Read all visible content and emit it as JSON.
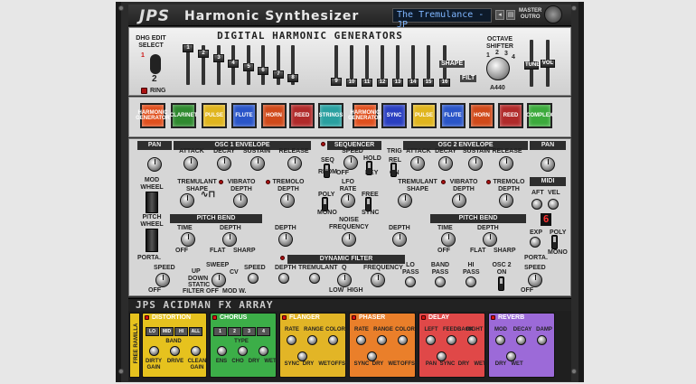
{
  "header": {
    "logo": "JPS",
    "product_name": "Harmonic Synthesizer",
    "patch_name": "The Tremulance - JP",
    "master_outro": [
      "MASTER",
      "OUTRO"
    ]
  },
  "dhg": {
    "title": "DIGITAL HARMONIC GENERATORS",
    "edit_select": [
      "DHG EDIT",
      "SELECT"
    ],
    "edit_values": [
      "1",
      "2"
    ],
    "ring_label": "RING",
    "slider_caps": [
      "1",
      "2",
      "3",
      "4",
      "5",
      "6",
      "7",
      "8",
      "9",
      "10",
      "11",
      "12",
      "13",
      "14",
      "15",
      "16"
    ],
    "shape_label": "SHAPE",
    "filt_label": "FILT",
    "octave_shifter": [
      "OCTAVE",
      "SHIFTER"
    ],
    "octave_marks": [
      "1",
      "2",
      "3",
      "4"
    ],
    "tune_label": "TUNE",
    "vol_label": "VOL",
    "a440": "A440"
  },
  "voices_left": [
    {
      "label": "HARMONIC GENERATOR",
      "color": "#e0501e"
    },
    {
      "label": "CLARINET",
      "color": "#2f8a2f"
    },
    {
      "label": "PULSE",
      "color": "#e0b51e"
    },
    {
      "label": "FLUTE",
      "color": "#2a55c8"
    },
    {
      "label": "HORN",
      "color": "#d04a1a"
    },
    {
      "label": "REED",
      "color": "#b02a2a"
    },
    {
      "label": "STRINGS",
      "color": "#2aa0a0"
    }
  ],
  "voices_right": [
    {
      "label": "HARMONIC GENERATOR",
      "color": "#e0501e"
    },
    {
      "label": "SYNC",
      "color": "#2a3fc0"
    },
    {
      "label": "PULSE",
      "color": "#e0b51e"
    },
    {
      "label": "FLUTE",
      "color": "#2a55c8"
    },
    {
      "label": "HORN",
      "color": "#d04a1a"
    },
    {
      "label": "REED",
      "color": "#b02a2a"
    },
    {
      "label": "COMPLEX",
      "color": "#3caa3c"
    }
  ],
  "panel": {
    "pan": "PAN",
    "osc1_env": "OSC 1 ENVELOPE",
    "osc2_env": "OSC 2 ENVELOPE",
    "env_labels": [
      "ATTACK",
      "DECAY",
      "SUSTAIN",
      "RELEASE"
    ],
    "sequencer": "SEQUENCER",
    "speed": "SPEED",
    "seq": "SEQ",
    "rndm": "RNDM",
    "off": "OFF",
    "hold": "HOLD",
    "key": "KEY",
    "trig": "TRIG",
    "rel": "REL",
    "on": "ON",
    "mod_wheel": [
      "MOD",
      "WHEEL"
    ],
    "pitch_wheel": [
      "PITCH",
      "WHEEL"
    ],
    "tremulant_shape": [
      "TREMULANT",
      "SHAPE"
    ],
    "vibrato_depth": [
      "VIBRATO",
      "DEPTH"
    ],
    "tremolo_depth": [
      "TREMOLO",
      "DEPTH"
    ],
    "lfo_rate": [
      "LFO",
      "RATE"
    ],
    "poly": "POLY",
    "mono": "MONO",
    "free": "FREE",
    "sync": "SYNC",
    "midi": "MIDI",
    "aft": "AFT",
    "vel": "VEL",
    "exp": "EXP",
    "pitch_bend": "PITCH BEND",
    "time": "TIME",
    "depth": "DEPTH",
    "flat": "FLAT",
    "sharp": "SHARP",
    "noise_frequency": [
      "NOISE",
      "FREQUENCY"
    ],
    "digit": "6",
    "porta": "PORTA.",
    "dynamic_filter": "DYNAMIC FILTER",
    "sweep": "SWEEP",
    "up": "UP",
    "down": "DOWN",
    "static": "STATIC",
    "filter_off": "FILTER OFF",
    "cv": "CV",
    "mod_w": "MOD W.",
    "tremulant": "TREMULANT",
    "q": "Q",
    "low": "LOW",
    "high": "HIGH",
    "frequency": "FREQUENCY",
    "lo_pass": [
      "LO",
      "PASS"
    ],
    "band_pass": [
      "BAND",
      "PASS"
    ],
    "hi_pass": [
      "HI",
      "PASS"
    ],
    "osc2_on": [
      "OSC 2",
      "ON"
    ]
  },
  "fx": {
    "title": "ACIDMAN FX ARRAY",
    "side_label": "FREE RAMILLA",
    "units": [
      {
        "name": "DISTORTION",
        "color": "#e6c21e",
        "btns": [
          "LO",
          "MID",
          "HI",
          "ALL"
        ],
        "labels": [
          "BAND",
          "DIRTY GAIN",
          "DRIVE",
          "CLEAN GAIN"
        ]
      },
      {
        "name": "CHORUS",
        "color": "#3cae48",
        "btns": [
          "1",
          "2",
          "3",
          "4"
        ],
        "labels": [
          "TYPE",
          "ENS",
          "CHO",
          "DRY",
          "WET"
        ]
      },
      {
        "name": "FLANGER",
        "color": "#e2b526",
        "labels": [
          "RATE",
          "RANGE",
          "COLOR",
          "SYNC",
          "DRY",
          "WET",
          "OFFSET"
        ]
      },
      {
        "name": "PHASER",
        "color": "#ea7f2a",
        "labels": [
          "RATE",
          "RANGE",
          "COLOR",
          "SYNC",
          "DRY",
          "WET",
          "OFFSET"
        ]
      },
      {
        "name": "DELAY",
        "color": "#e04848",
        "labels": [
          "LEFT",
          "FEEDBACK",
          "RIGHT",
          "PAN",
          "SYNC",
          "DRY",
          "WET"
        ]
      },
      {
        "name": "REVERB",
        "color": "#9c6ad8",
        "labels": [
          "MOD",
          "DECAY",
          "DAMP",
          "DRY",
          "WET"
        ]
      }
    ]
  }
}
